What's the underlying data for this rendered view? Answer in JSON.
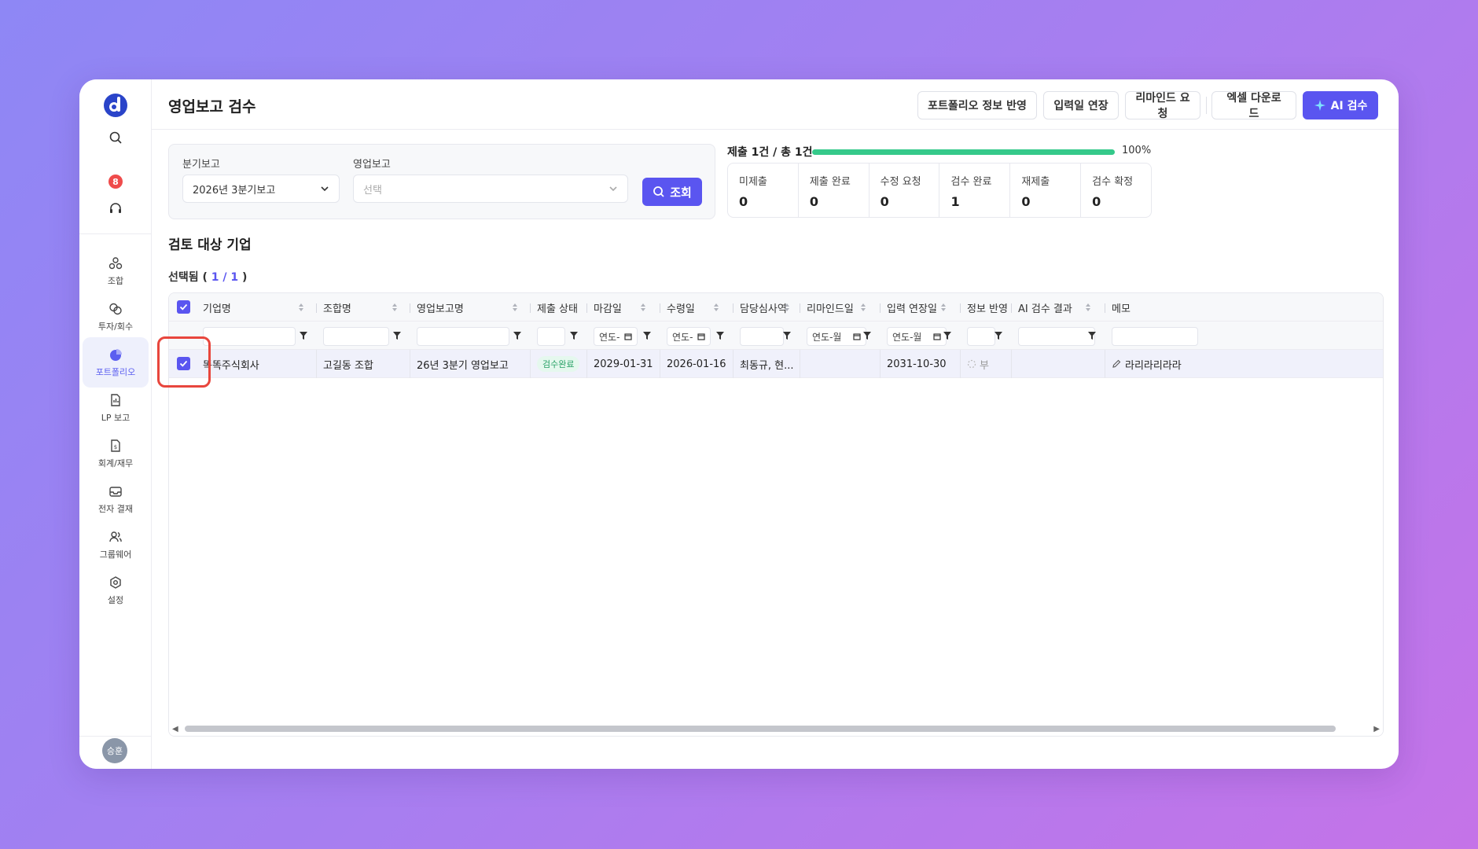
{
  "app": {
    "title": "영업보고 검수"
  },
  "sidebar": {
    "badge_count": "8",
    "items": [
      {
        "label": "조합",
        "icon": "cluster-icon"
      },
      {
        "label": "투자/회수",
        "icon": "coins-icon"
      },
      {
        "label": "포트폴리오",
        "icon": "pie-chart-icon",
        "active": true
      },
      {
        "label": "LP 보고",
        "icon": "report-doc-icon"
      },
      {
        "label": "회계/재무",
        "icon": "finance-doc-icon"
      },
      {
        "label": "전자 결재",
        "icon": "inbox-icon"
      },
      {
        "label": "그룹웨어",
        "icon": "users-icon"
      },
      {
        "label": "설정",
        "icon": "settings-icon"
      }
    ],
    "avatar_text": "승훈"
  },
  "header": {
    "buttons": {
      "portfolio_sync": "포트폴리오 정보 반영",
      "extend_input": "입력일 연장",
      "remind": "리마인드 요청",
      "excel": "엑셀 다운로드",
      "ai_review": "AI 검수"
    }
  },
  "filters": {
    "quarter_label": "분기보고",
    "quarter_value": "2026년 3분기보고",
    "report_label": "영업보고",
    "report_placeholder": "선택",
    "search_button": "조회"
  },
  "progress": {
    "label": "제출 1건 / 총 1건",
    "percent_text": "100%",
    "percent": 100
  },
  "stats": [
    {
      "label": "미제출",
      "value": "0"
    },
    {
      "label": "제출 완료",
      "value": "0"
    },
    {
      "label": "수정 요청",
      "value": "0"
    },
    {
      "label": "검수 완료",
      "value": "1"
    },
    {
      "label": "재제출",
      "value": "0"
    },
    {
      "label": "검수 확정",
      "value": "0"
    }
  ],
  "section": {
    "title": "검토 대상 기업",
    "selected_prefix": "선택됨 ( ",
    "selected_count": "1 / 1",
    "selected_suffix": " )"
  },
  "table": {
    "columns": {
      "company": "기업명",
      "fund": "조합명",
      "report_name": "영업보고명",
      "status": "제출 상태",
      "deadline": "마감일",
      "received": "수령일",
      "reviewer": "담당심사역",
      "remind_date": "리마인드일",
      "extended": "입력 연장일",
      "info_sync": "정보 반영",
      "ai_result": "AI 검수 결과",
      "memo": "메모"
    },
    "date_filter_placeholder": "연도-",
    "date_filter_placeholder_2": "연도-월",
    "row": {
      "company": "똑똑주식회사",
      "fund": "고길동 조합",
      "report_name": "26년 3분기 영업보고",
      "status": "검수완료",
      "deadline": "2029-01-31",
      "received": "2026-01-16",
      "reviewer": "최동규, 현...",
      "remind_date": "",
      "extended": "2031-10-30",
      "info_sync": "부",
      "ai_result": "",
      "memo": "라리라리라라"
    }
  },
  "colors": {
    "accent": "#5a55f0",
    "success": "#35c98a",
    "highlight": "#e8463d"
  }
}
